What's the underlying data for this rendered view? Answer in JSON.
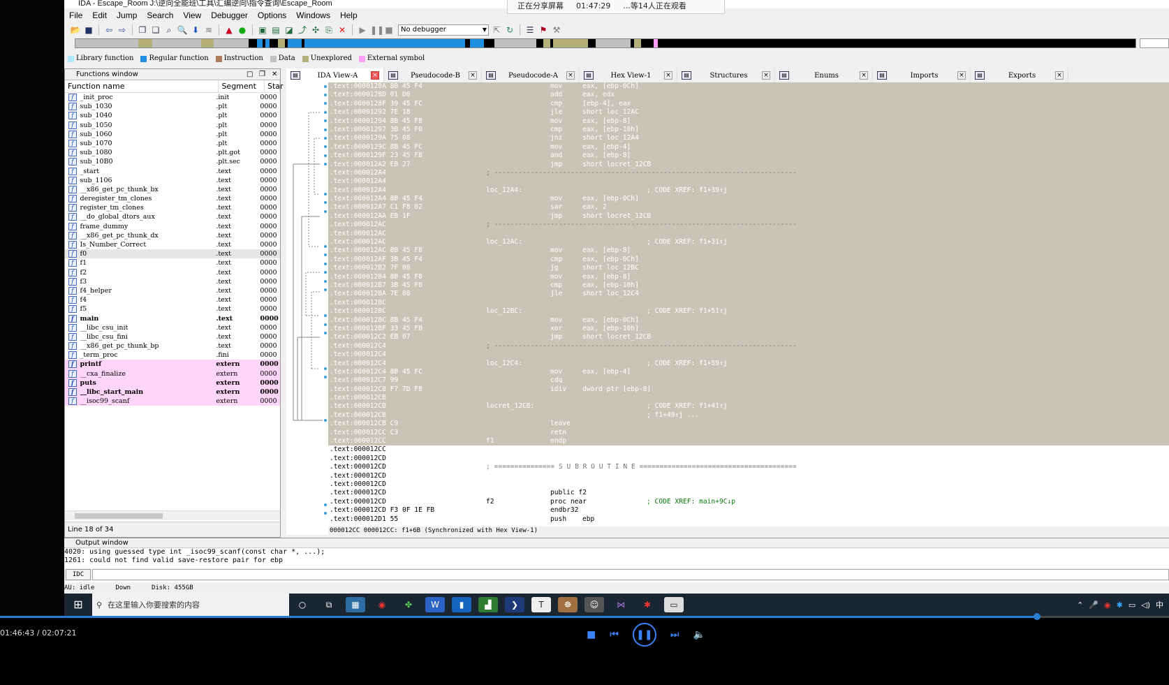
{
  "window": {
    "title": "IDA - Escape_Room J:\\逆向全能班\\工具\\汇编逆向\\指令查询\\Escape_Room"
  },
  "share_banner": {
    "text": "正在分享屏幕",
    "time": "01:47:29",
    "viewers": "...等14人正在观看"
  },
  "menu": [
    "File",
    "Edit",
    "Jump",
    "Search",
    "View",
    "Debugger",
    "Options",
    "Windows",
    "Help"
  ],
  "toolbar": {
    "debugger": "No debugger"
  },
  "legend": [
    {
      "label": "Library function",
      "color": "#aee8ff"
    },
    {
      "label": "Regular function",
      "color": "#1f8fe0"
    },
    {
      "label": "Instruction",
      "color": "#b07a5e"
    },
    {
      "label": "Data",
      "color": "#c0c0c0"
    },
    {
      "label": "Unexplored",
      "color": "#b5b07a"
    },
    {
      "label": "External symbol",
      "color": "#ff9ef5"
    }
  ],
  "functions_window": {
    "title": "Functions window",
    "columns": [
      "Function name",
      "Segment",
      "Star"
    ],
    "rows": [
      {
        "name": "_init_proc",
        "segment": ".init",
        "start": "0000"
      },
      {
        "name": "sub_1030",
        "segment": ".plt",
        "start": "0000"
      },
      {
        "name": "sub_1040",
        "segment": ".plt",
        "start": "0000"
      },
      {
        "name": "sub_1050",
        "segment": ".plt",
        "start": "0000"
      },
      {
        "name": "sub_1060",
        "segment": ".plt",
        "start": "0000"
      },
      {
        "name": "sub_1070",
        "segment": ".plt",
        "start": "0000"
      },
      {
        "name": "sub_1080",
        "segment": ".plt.got",
        "start": "0000"
      },
      {
        "name": "sub_10B0",
        "segment": ".plt.sec",
        "start": "0000"
      },
      {
        "name": "_start",
        "segment": ".text",
        "start": "0000"
      },
      {
        "name": "sub_1106",
        "segment": ".text",
        "start": "0000"
      },
      {
        "name": "__x86_get_pc_thunk_bx",
        "segment": ".text",
        "start": "0000"
      },
      {
        "name": "deregister_tm_clones",
        "segment": ".text",
        "start": "0000"
      },
      {
        "name": "register_tm_clones",
        "segment": ".text",
        "start": "0000"
      },
      {
        "name": "__do_global_dtors_aux",
        "segment": ".text",
        "start": "0000"
      },
      {
        "name": "frame_dummy",
        "segment": ".text",
        "start": "0000"
      },
      {
        "name": "__x86_get_pc_thunk_dx",
        "segment": ".text",
        "start": "0000"
      },
      {
        "name": "Is_Number_Correct",
        "segment": ".text",
        "start": "0000"
      },
      {
        "name": "f0",
        "segment": ".text",
        "start": "0000",
        "selected": true
      },
      {
        "name": "f1",
        "segment": ".text",
        "start": "0000"
      },
      {
        "name": "f2",
        "segment": ".text",
        "start": "0000"
      },
      {
        "name": "f3",
        "segment": ".text",
        "start": "0000"
      },
      {
        "name": "f4_helper",
        "segment": ".text",
        "start": "0000"
      },
      {
        "name": "f4",
        "segment": ".text",
        "start": "0000"
      },
      {
        "name": "f5",
        "segment": ".text",
        "start": "0000"
      },
      {
        "name": "main",
        "segment": ".text",
        "start": "0000",
        "bold": true
      },
      {
        "name": "__libc_csu_init",
        "segment": ".text",
        "start": "0000"
      },
      {
        "name": "__libc_csu_fini",
        "segment": ".text",
        "start": "0000"
      },
      {
        "name": "__x86_get_pc_thunk_bp",
        "segment": ".text",
        "start": "0000"
      },
      {
        "name": "_term_proc",
        "segment": ".fini",
        "start": "0000"
      },
      {
        "name": "printf",
        "segment": "extern",
        "start": "0000",
        "extern": true,
        "bold": true
      },
      {
        "name": "__cxa_finalize",
        "segment": "extern",
        "start": "0000",
        "extern": true
      },
      {
        "name": "puts",
        "segment": "extern",
        "start": "0000",
        "extern": true,
        "bold": true
      },
      {
        "name": "__libc_start_main",
        "segment": "extern",
        "start": "0000",
        "extern": true,
        "bold": true
      },
      {
        "name": "__isoc99_scanf",
        "segment": "extern",
        "start": "0000",
        "extern": true
      }
    ],
    "status": "Line 18 of 34"
  },
  "tabs": [
    {
      "label": "IDA View-A",
      "active": true
    },
    {
      "label": "Pseudocode-B"
    },
    {
      "label": "Pseudocode-A"
    },
    {
      "label": "Hex View-1"
    },
    {
      "label": "Structures"
    },
    {
      "label": "Enums"
    },
    {
      "label": "Imports"
    },
    {
      "label": "Exports"
    }
  ],
  "disasm": {
    "lines": [
      {
        "a": ".text:0000128A 8B 45 F4",
        "m": "mov",
        "o": "eax, [ebp-0Ch]",
        "hl": true
      },
      {
        "a": ".text:0000128D 01 D0",
        "m": "add",
        "o": "eax, edx",
        "hl": true
      },
      {
        "a": ".text:0000128F 39 45 FC",
        "m": "cmp",
        "o": "[ebp-4], eax",
        "hl": true
      },
      {
        "a": ".text:00001292 7E 18",
        "m": "jle",
        "o": "short loc_12AC",
        "hl": true
      },
      {
        "a": ".text:00001294 8B 45 F8",
        "m": "mov",
        "o": "eax, [ebp-8]",
        "hl": true
      },
      {
        "a": ".text:00001297 3B 45 F0",
        "m": "cmp",
        "o": "eax, [ebp-10h]",
        "hl": true
      },
      {
        "a": ".text:0000129A 75 08",
        "m": "jnz",
        "o": "short loc_12A4",
        "hl": true
      },
      {
        "a": ".text:0000129C 8B 45 FC",
        "m": "mov",
        "o": "eax, [ebp-4]",
        "hl": true
      },
      {
        "a": ".text:0000129F 23 45 F8",
        "m": "and",
        "o": "eax, [ebp-8]",
        "hl": true
      },
      {
        "a": ".text:000012A2 EB 27",
        "m": "jmp",
        "o": "short locret_12CB",
        "hl": true
      },
      {
        "a": ".text:000012A4",
        "sep": "; ---------------------------------------------------------------------------",
        "hl": true
      },
      {
        "a": ".text:000012A4",
        "hl": true
      },
      {
        "a": ".text:000012A4",
        "l": "loc_12A4:",
        "c": "; CODE XREF: f1+39↑j",
        "hl": true
      },
      {
        "a": ".text:000012A4 8B 45 F4",
        "m": "mov",
        "o": "eax, [ebp-0Ch]",
        "hl": true
      },
      {
        "a": ".text:000012A7 C1 F8 02",
        "m": "sar",
        "o": "eax, 2",
        "hl": true
      },
      {
        "a": ".text:000012AA EB 1F",
        "m": "jmp",
        "o": "short locret_12CB",
        "hl": true
      },
      {
        "a": ".text:000012AC",
        "sep": "; ---------------------------------------------------------------------------",
        "hl": true
      },
      {
        "a": ".text:000012AC",
        "hl": true
      },
      {
        "a": ".text:000012AC",
        "l": "loc_12AC:",
        "c": "; CODE XREF: f1+31↑j",
        "hl": true
      },
      {
        "a": ".text:000012AC 8B 45 F8",
        "m": "mov",
        "o": "eax, [ebp-8]",
        "hl": true
      },
      {
        "a": ".text:000012AF 3B 45 F4",
        "m": "cmp",
        "o": "eax, [ebp-0Ch]",
        "hl": true
      },
      {
        "a": ".text:000012B2 7F 08",
        "m": "jg",
        "o": "short loc_12BC",
        "hl": true
      },
      {
        "a": ".text:000012B4 8B 45 F8",
        "m": "mov",
        "o": "eax, [ebp-8]",
        "hl": true
      },
      {
        "a": ".text:000012B7 3B 45 F0",
        "m": "cmp",
        "o": "eax, [ebp-10h]",
        "hl": true
      },
      {
        "a": ".text:000012BA 7E 08",
        "m": "jle",
        "o": "short loc_12C4",
        "hl": true
      },
      {
        "a": ".text:000012BC",
        "hl": true
      },
      {
        "a": ".text:000012BC",
        "l": "loc_12BC:",
        "c": "; CODE XREF: f1+51↑j",
        "hl": true
      },
      {
        "a": ".text:000012BC 8B 45 F4",
        "m": "mov",
        "o": "eax, [ebp-0Ch]",
        "hl": true
      },
      {
        "a": ".text:000012BF 33 45 F0",
        "m": "xor",
        "o": "eax, [ebp-10h]",
        "hl": true
      },
      {
        "a": ".text:000012C2 EB 07",
        "m": "jmp",
        "o": "short locret_12CB",
        "hl": true
      },
      {
        "a": ".text:000012C4",
        "sep": "; ---------------------------------------------------------------------------",
        "hl": true
      },
      {
        "a": ".text:000012C4",
        "hl": true
      },
      {
        "a": ".text:000012C4",
        "l": "loc_12C4:",
        "c": "; CODE XREF: f1+59↑j",
        "hl": true
      },
      {
        "a": ".text:000012C4 8B 45 FC",
        "m": "mov",
        "o": "eax, [ebp-4]",
        "hl": true
      },
      {
        "a": ".text:000012C7 99",
        "m": "cdq",
        "o": "",
        "hl": true
      },
      {
        "a": ".text:000012C8 F7 7D F8",
        "m": "idiv",
        "o": "dword ptr [ebp-8]",
        "hl": true
      },
      {
        "a": ".text:000012CB",
        "hl": true
      },
      {
        "a": ".text:000012CB",
        "l": "locret_12CB:",
        "c": "; CODE XREF: f1+41↑j",
        "hl": true
      },
      {
        "a": ".text:000012CB",
        "c": "; f1+49↑j ...",
        "hl": true
      },
      {
        "a": ".text:000012CB C9",
        "m": "leave",
        "o": "",
        "hl": true
      },
      {
        "a": ".text:000012CC C3",
        "m": "retn",
        "o": "",
        "hl": true
      },
      {
        "a": ".text:000012CC",
        "l": "f1",
        "m": "endp",
        "o": "",
        "hl": true
      },
      {
        "a": ".text:000012CC"
      },
      {
        "a": ".text:000012CD"
      },
      {
        "a": ".text:000012CD",
        "sep": "; =============== S U B R O U T I N E ======================================="
      },
      {
        "a": ".text:000012CD"
      },
      {
        "a": ".text:000012CD"
      },
      {
        "a": ".text:000012CD",
        "m": "public f2"
      },
      {
        "a": ".text:000012CD",
        "l": "f2",
        "m": "proc near",
        "c": "; CODE XREF: main+9C↓p"
      },
      {
        "a": ".text:000012CD F3 0F 1E FB",
        "m": "endbr32",
        "o": ""
      },
      {
        "a": ".text:000012D1 55",
        "m": "push",
        "o": "ebp"
      }
    ],
    "status": "000012CC 000012CC: f1+6B (Synchronized with Hex View-1)"
  },
  "output": {
    "title": "Output window",
    "lines": [
      "4020: using guessed type int _isoc99_scanf(const char *, ...);",
      "1261: could not find valid save-restore pair for ebp"
    ],
    "idc_label": "IDC"
  },
  "ida_status": {
    "state": "AU:  idle",
    "direction": "Down",
    "disk": "Disk: 455GB"
  },
  "taskbar": {
    "search_placeholder": "在这里输入你要搜索的内容",
    "ime": "中"
  },
  "player": {
    "time": "01:46:43 / 02:07:21",
    "progress": 0.887
  }
}
